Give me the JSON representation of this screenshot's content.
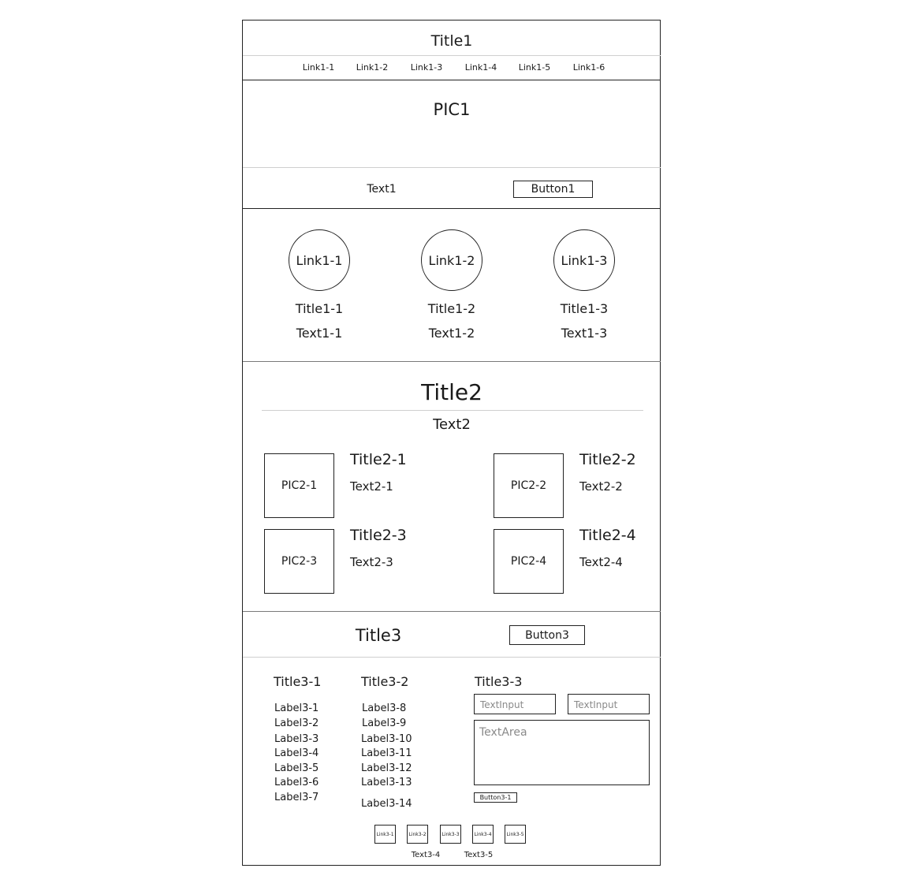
{
  "header": {
    "title": "Title1",
    "links": [
      "Link1-1",
      "Link1-2",
      "Link1-3",
      "Link1-4",
      "Link1-5",
      "Link1-6"
    ]
  },
  "hero": {
    "pic": "PIC1",
    "text": "Text1",
    "button": "Button1"
  },
  "features": [
    {
      "link": "Link1-1",
      "title": "Title1-1",
      "text": "Text1-1"
    },
    {
      "link": "Link1-2",
      "title": "Title1-2",
      "text": "Text1-2"
    },
    {
      "link": "Link1-3",
      "title": "Title1-3",
      "text": "Text1-3"
    }
  ],
  "section2": {
    "title": "Title2",
    "text": "Text2",
    "items": [
      {
        "pic": "PIC2-1",
        "title": "Title2-1",
        "text": "Text2-1"
      },
      {
        "pic": "PIC2-2",
        "title": "Title2-2",
        "text": "Text2-2"
      },
      {
        "pic": "PIC2-3",
        "title": "Title2-3",
        "text": "Text2-3"
      },
      {
        "pic": "PIC2-4",
        "title": "Title2-4",
        "text": "Text2-4"
      }
    ]
  },
  "section3": {
    "title": "Title3",
    "button": "Button3",
    "col1": {
      "title": "Title3-1",
      "labels": [
        "Label3-1",
        "Label3-2",
        "Label3-3",
        "Label3-4",
        "Label3-5",
        "Label3-6",
        "Label3-7"
      ]
    },
    "col2": {
      "title": "Title3-2",
      "labels": [
        "Label3-8",
        "Label3-9",
        "Label3-10",
        "Label3-11",
        "Label3-12",
        "Label3-13",
        "Label3-14"
      ]
    },
    "form": {
      "title": "Title3-3",
      "input1_placeholder": "TextInput",
      "input2_placeholder": "TextInput",
      "textarea_placeholder": "TextArea",
      "button": "Button3-1"
    },
    "footer_links": [
      "Link3-1",
      "Link3-2",
      "Link3-3",
      "Link3-4",
      "Link3-5"
    ],
    "footer_texts": [
      "Text3-4",
      "Text3-5"
    ]
  }
}
